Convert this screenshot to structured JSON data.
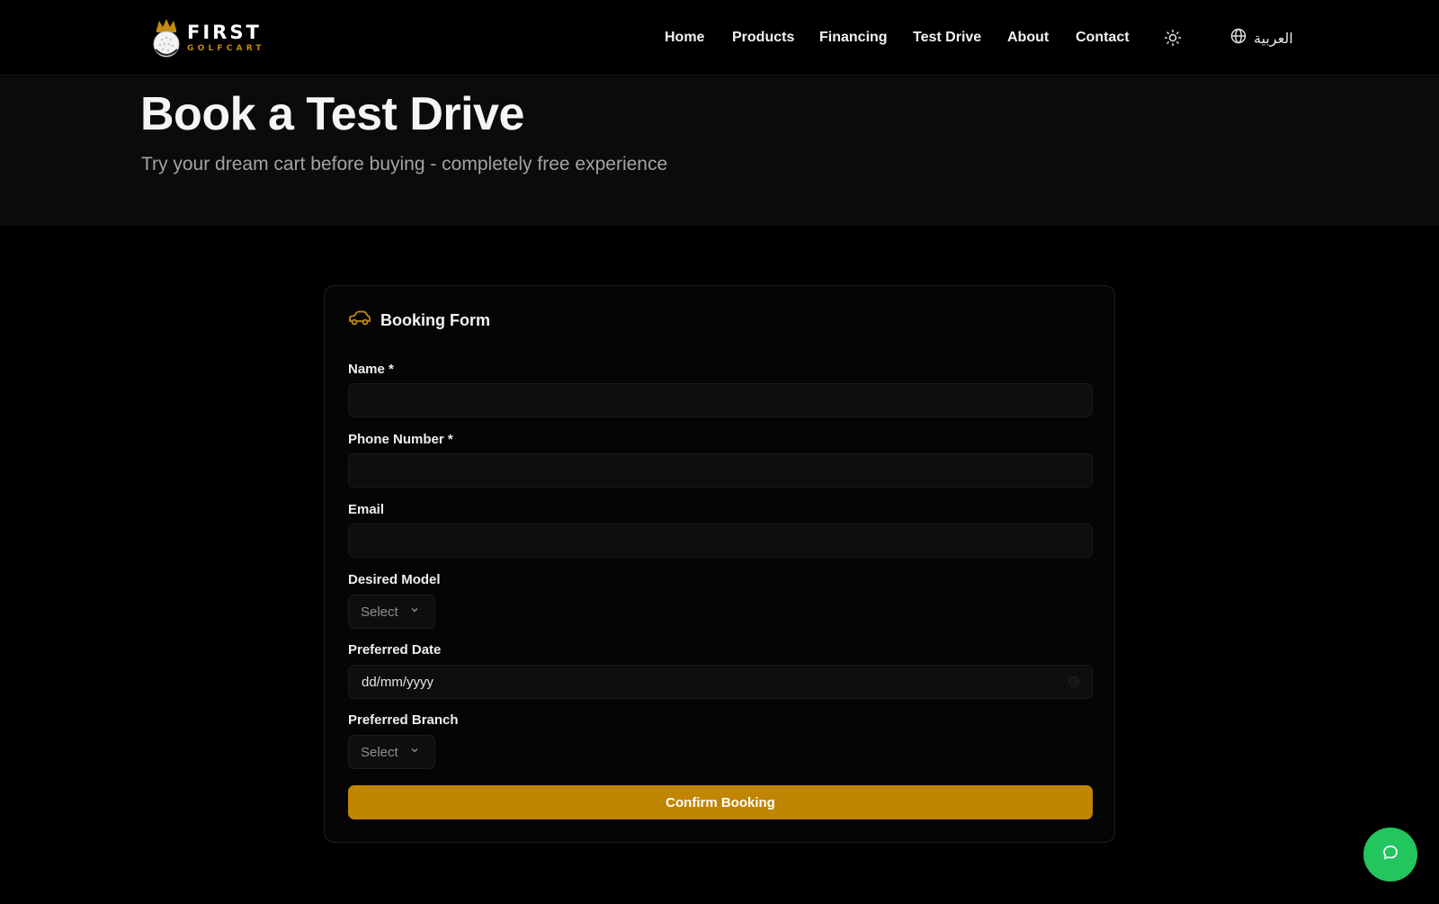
{
  "brand": {
    "title": "FIRST",
    "subtitle": "GOLFCART",
    "accent": "#c18504"
  },
  "nav": {
    "items": [
      {
        "label": "Home"
      },
      {
        "label": "Products"
      },
      {
        "label": "Financing"
      },
      {
        "label": "Test Drive"
      },
      {
        "label": "About"
      },
      {
        "label": "Contact"
      }
    ],
    "theme_icon": "sun-icon",
    "language_icon": "globe-icon",
    "language_label": "العربية"
  },
  "hero": {
    "title": "Book a Test Drive",
    "subtitle": "Try your dream cart before buying - completely free experience"
  },
  "form": {
    "icon": "car-icon",
    "title": "Booking Form",
    "name_label": "Name *",
    "name_value": "",
    "phone_label": "Phone Number *",
    "phone_value": "",
    "email_label": "Email",
    "email_value": "",
    "model_label": "Desired Model",
    "model_value": "Select",
    "date_label": "Preferred Date",
    "date_placeholder": "dd/mm/yyyy",
    "branch_label": "Preferred Branch",
    "branch_value": "Select",
    "submit_label": "Confirm Booking"
  },
  "chat": {
    "icon": "chat-bubble-icon",
    "color": "#22c55e"
  }
}
